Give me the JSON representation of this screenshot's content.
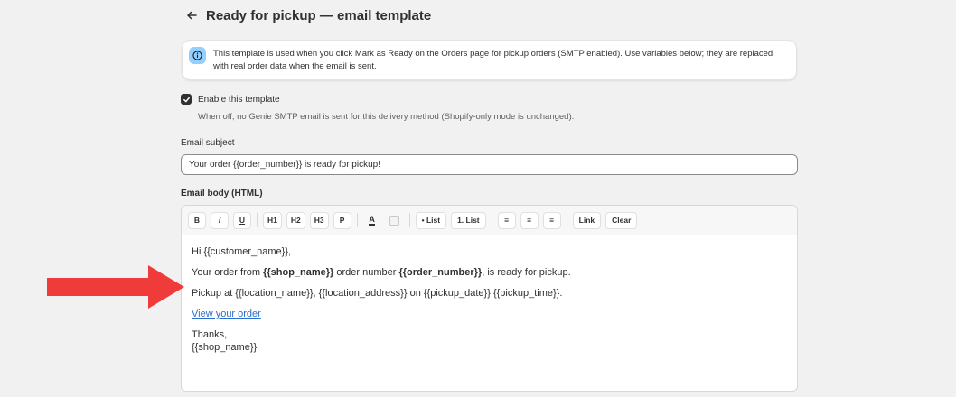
{
  "header": {
    "title": "Ready for pickup — email template"
  },
  "banner": {
    "text": "This template is used when you click Mark as Ready on the Orders page for pickup orders (SMTP enabled). Use variables below; they are replaced with real order data when the email is sent."
  },
  "enable": {
    "checked": true,
    "label": "Enable this template",
    "help": "When off, no Genie SMTP email is sent for this delivery method (Shopify-only mode is unchanged)."
  },
  "subject": {
    "label": "Email subject",
    "value": "Your order {{order_number}} is ready for pickup!"
  },
  "body_editor": {
    "label": "Email body (HTML)",
    "toolbar": {
      "bold": "B",
      "italic": "I",
      "underline": "U",
      "h1": "H1",
      "h2": "H2",
      "h3": "H3",
      "p": "P",
      "text_color": "A",
      "bullet_list": "• List",
      "numbered_list": "1. List",
      "align_left": "≡",
      "align_center": "≡",
      "align_right": "≡",
      "link": "Link",
      "clear": "Clear"
    },
    "content": {
      "greeting": "Hi {{customer_name}},",
      "line1_prefix": "Your order from ",
      "line1_shop": "{{shop_name}}",
      "line1_mid": " order number ",
      "line1_order": "{{order_number}}",
      "line1_suffix": ", is ready for pickup.",
      "line2": "Pickup at {{location_name}}, {{location_address}} on {{pickup_date}} {{pickup_time}}.",
      "link": "View your order",
      "thanks": "Thanks,",
      "signature": "{{shop_name}}"
    }
  },
  "colors": {
    "accent_arrow": "#f03b3b",
    "info_icon_bg": "#91d0ff",
    "link": "#2c6ecb"
  }
}
